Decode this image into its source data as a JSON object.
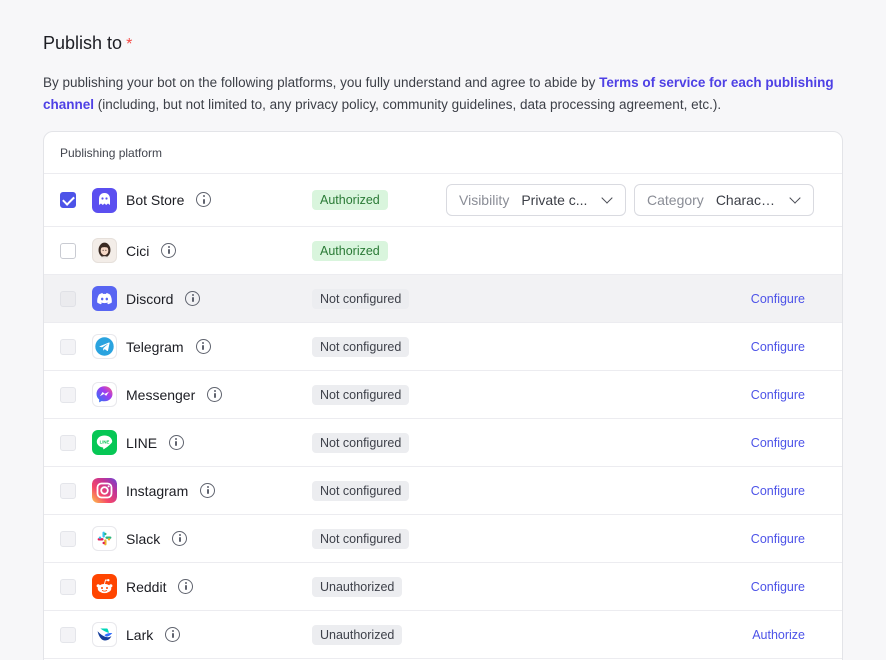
{
  "section": {
    "title": "Publish to",
    "required_mark": "*",
    "desc_pre": "By publishing your bot on the following platforms, you fully understand and agree to abide by ",
    "desc_link": "Terms of service for each publishing channel",
    "desc_post": " (including, but not limited to, any privacy policy, community guidelines, data processing agreement, etc.)."
  },
  "table": {
    "header": "Publishing platform",
    "visibility": {
      "label": "Visibility",
      "value": "Private c..."
    },
    "category": {
      "label": "Category",
      "value": "Charact..."
    },
    "rows": [
      {
        "name": "Bot Store",
        "status": "Authorized",
        "status_type": "authorized",
        "action": "",
        "checked": true,
        "disabled": false,
        "icon": "bot-store-icon"
      },
      {
        "name": "Cici",
        "status": "Authorized",
        "status_type": "authorized",
        "action": "",
        "checked": false,
        "disabled": false,
        "icon": "cici-icon"
      },
      {
        "name": "Discord",
        "status": "Not configured",
        "status_type": "notconf",
        "action": "Configure",
        "checked": false,
        "disabled": true,
        "icon": "discord-icon"
      },
      {
        "name": "Telegram",
        "status": "Not configured",
        "status_type": "notconf",
        "action": "Configure",
        "checked": false,
        "disabled": true,
        "icon": "telegram-icon"
      },
      {
        "name": "Messenger",
        "status": "Not configured",
        "status_type": "notconf",
        "action": "Configure",
        "checked": false,
        "disabled": true,
        "icon": "messenger-icon"
      },
      {
        "name": "LINE",
        "status": "Not configured",
        "status_type": "notconf",
        "action": "Configure",
        "checked": false,
        "disabled": true,
        "icon": "line-icon"
      },
      {
        "name": "Instagram",
        "status": "Not configured",
        "status_type": "notconf",
        "action": "Configure",
        "checked": false,
        "disabled": true,
        "icon": "instagram-icon"
      },
      {
        "name": "Slack",
        "status": "Not configured",
        "status_type": "notconf",
        "action": "Configure",
        "checked": false,
        "disabled": true,
        "icon": "slack-icon"
      },
      {
        "name": "Reddit",
        "status": "Unauthorized",
        "status_type": "unauth",
        "action": "Configure",
        "checked": false,
        "disabled": true,
        "icon": "reddit-icon"
      },
      {
        "name": "Lark",
        "status": "Unauthorized",
        "status_type": "unauth",
        "action": "Authorize",
        "checked": false,
        "disabled": true,
        "icon": "lark-icon"
      }
    ]
  },
  "colors": {
    "accent": "#4d53e8",
    "link": "#4e40e5",
    "required": "#f54a45",
    "authorized_bg": "#d9f5dd",
    "authorized_text": "#2a7a36"
  }
}
